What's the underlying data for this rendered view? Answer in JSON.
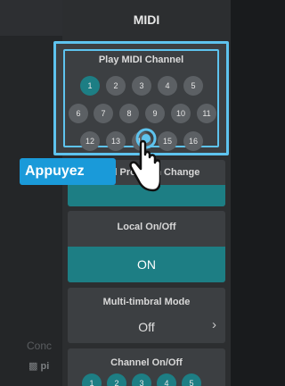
{
  "background": {
    "concert_partial": "Conc",
    "piano_partial": "pi"
  },
  "panel": {
    "title": "MIDI",
    "play_channel": {
      "label": "Play MIDI Channel",
      "selected": "1",
      "rows": [
        [
          "1",
          "2",
          "3",
          "4",
          "5"
        ],
        [
          "6",
          "7",
          "8",
          "9",
          "10",
          "11"
        ],
        [
          "12",
          "13",
          "14",
          "15",
          "16"
        ]
      ]
    },
    "program_change": {
      "label_left": "Send Pro",
      "label_right": "m Change"
    },
    "local": {
      "label": "Local On/Off",
      "value": "ON"
    },
    "multi_timbral": {
      "label": "Multi-timbral Mode",
      "value": "Off"
    },
    "channel_onoff": {
      "label": "Channel On/Off",
      "visible_channels": [
        "1",
        "2",
        "3",
        "4",
        "5"
      ]
    }
  },
  "overlay": {
    "tap_label": "Appuyez"
  },
  "colors": {
    "accent": "#1d7e84",
    "highlight": "#5ec3ee",
    "tap_badge": "#1a9ad9"
  }
}
